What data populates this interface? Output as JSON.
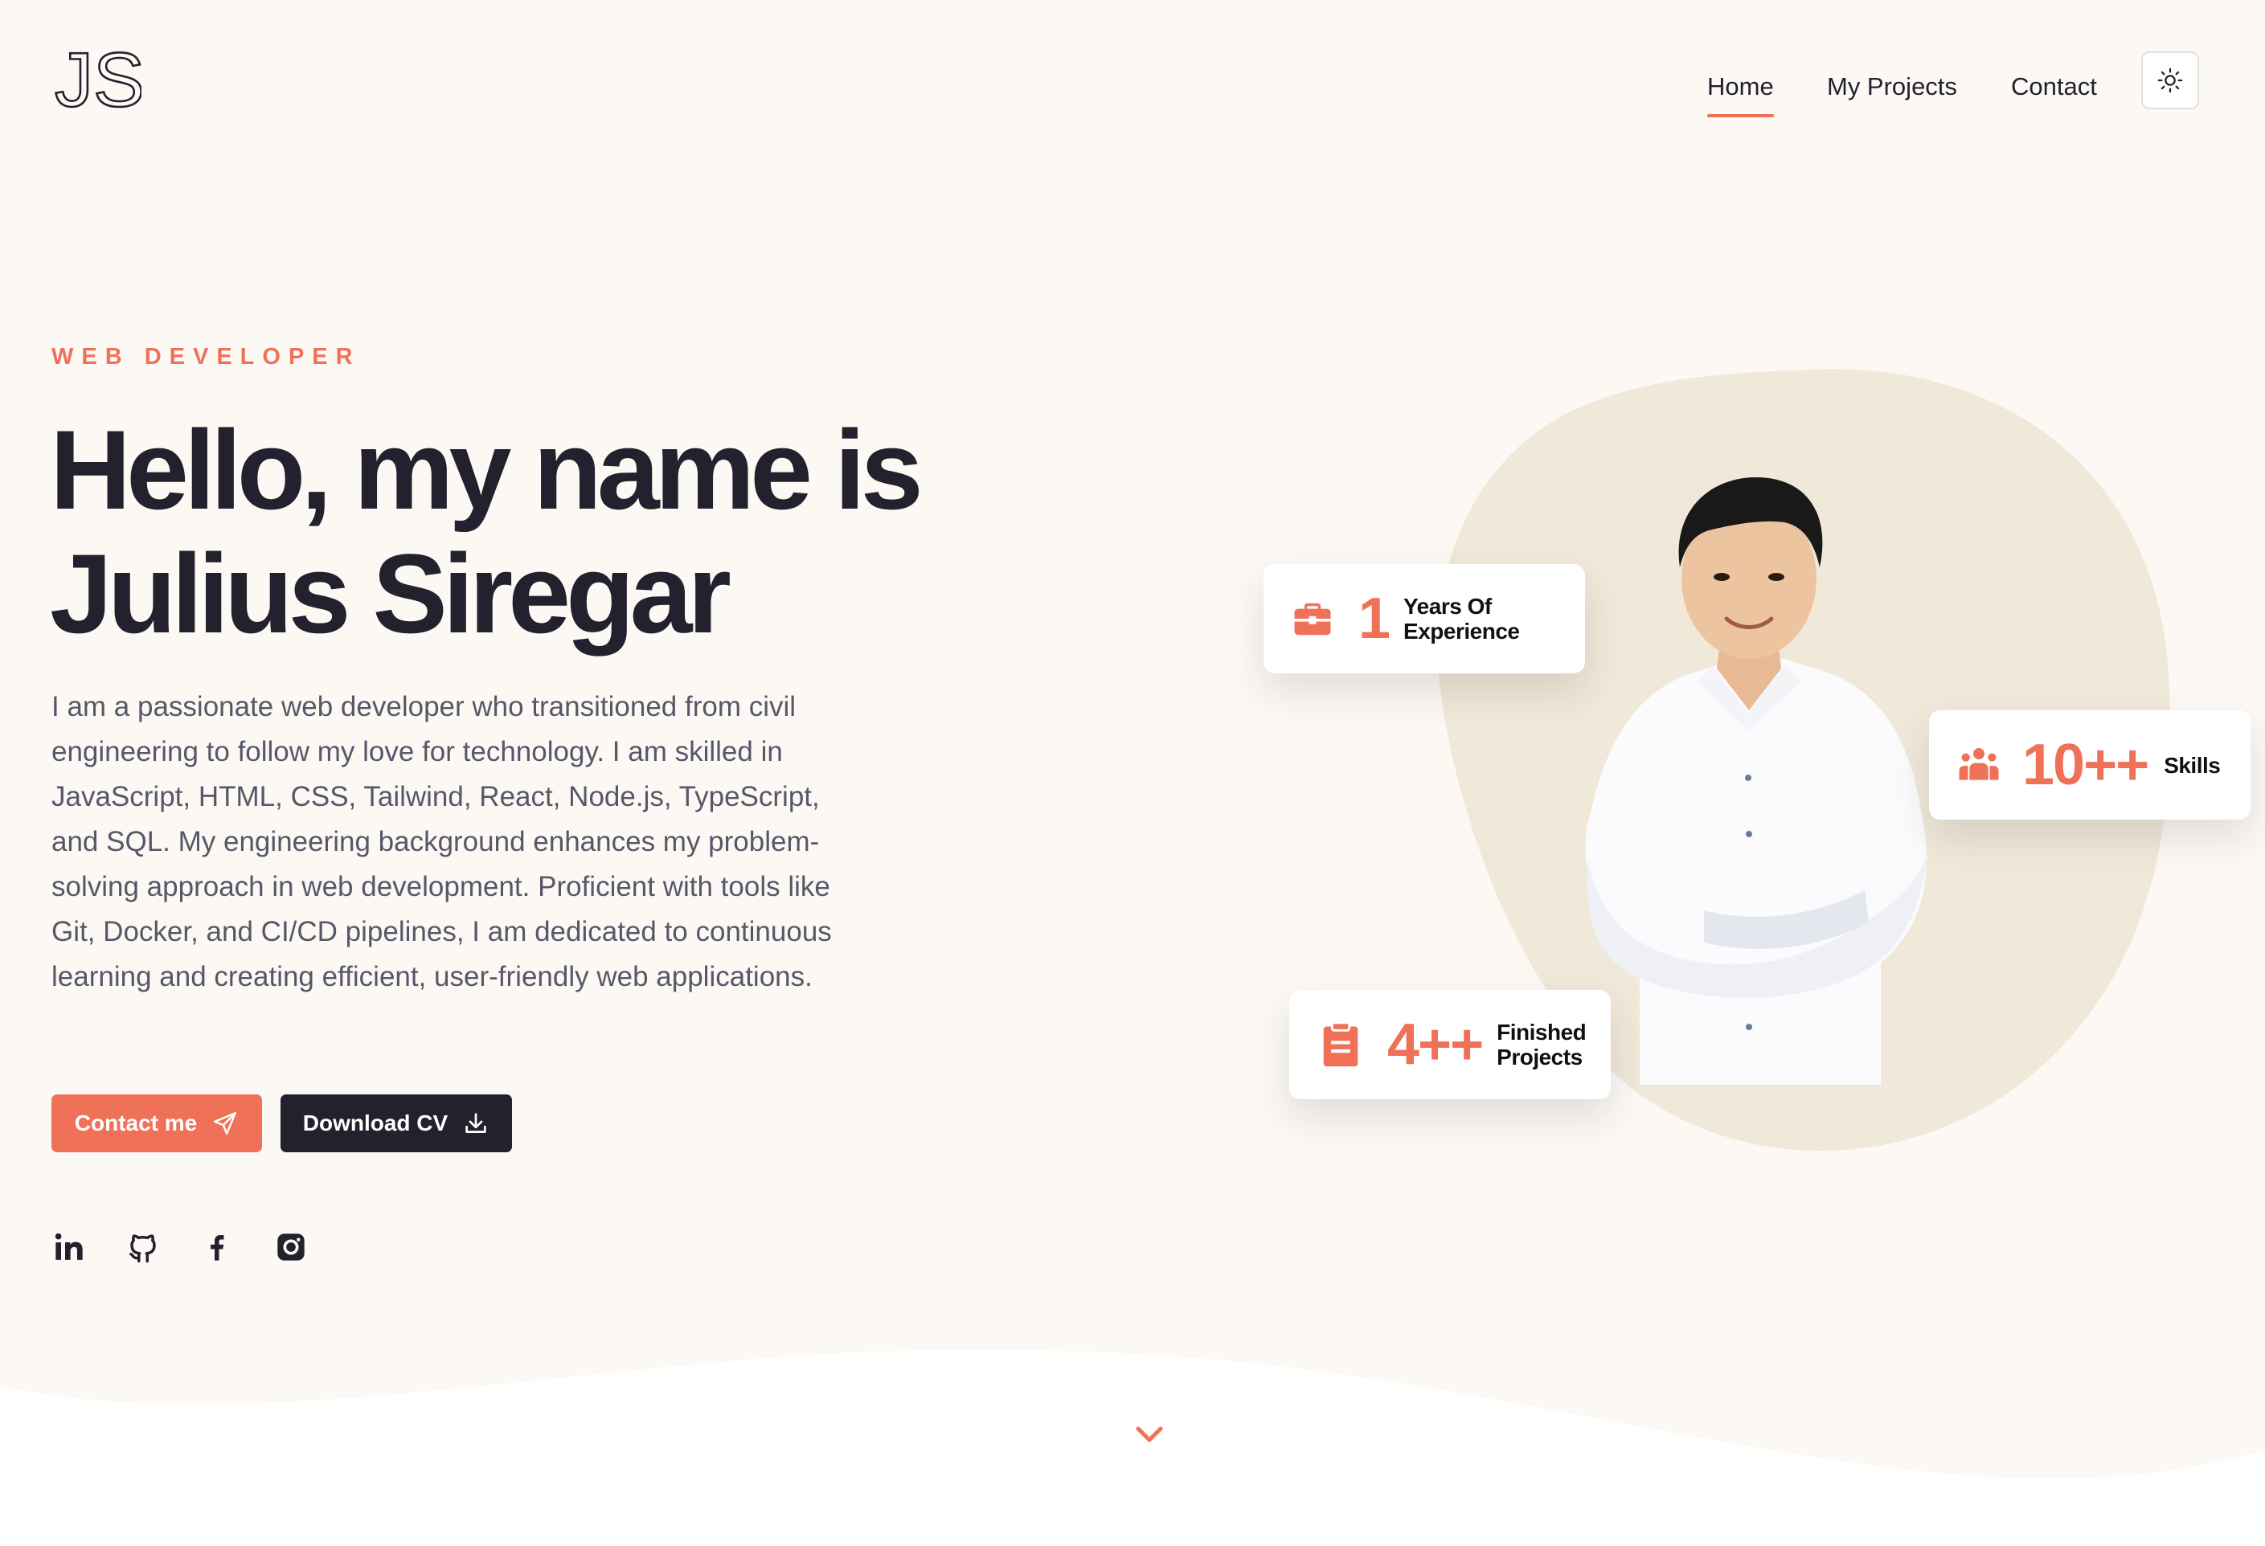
{
  "header": {
    "logo_text": "JS",
    "nav": [
      {
        "label": "Home",
        "active": true
      },
      {
        "label": "My Projects",
        "active": false
      },
      {
        "label": "Contact",
        "active": false
      }
    ],
    "theme_toggle_icon": "sun-icon"
  },
  "hero": {
    "eyebrow": "WEB DEVELOPER",
    "title_line1": "Hello, my name is",
    "title_line2": "Julius Siregar",
    "description": "I am a passionate web developer who transitioned from civil engineering to follow my love for technology. I am skilled in JavaScript, HTML, CSS, Tailwind, React, Node.js, TypeScript, and SQL. My engineering background enhances my problem-solving approach in web development. Proficient with tools like Git, Docker, and CI/CD pipelines, I am dedicated to continuous learning and creating efficient, user-friendly web applications.",
    "buttons": {
      "contact_label": "Contact me",
      "contact_icon": "send-icon",
      "cv_label": "Download CV",
      "cv_icon": "download-icon"
    },
    "socials": [
      {
        "name": "linkedin-icon"
      },
      {
        "name": "github-icon"
      },
      {
        "name": "facebook-icon"
      },
      {
        "name": "instagram-icon"
      }
    ]
  },
  "stats": {
    "experience": {
      "value": "1",
      "label_line1": "Years Of",
      "label_line2": "Experience",
      "icon": "briefcase-icon"
    },
    "skills": {
      "value": "10++",
      "label": "Skills",
      "icon": "users-icon"
    },
    "projects": {
      "value": "4++",
      "label_line1": "Finished",
      "label_line2": "Projects",
      "icon": "clipboard-icon"
    }
  },
  "scroll_indicator_icon": "chevron-down-icon",
  "colors": {
    "accent": "#ef7258",
    "dark": "#23212d",
    "background": "#fcf9f5",
    "blob": "#f0e9da"
  }
}
